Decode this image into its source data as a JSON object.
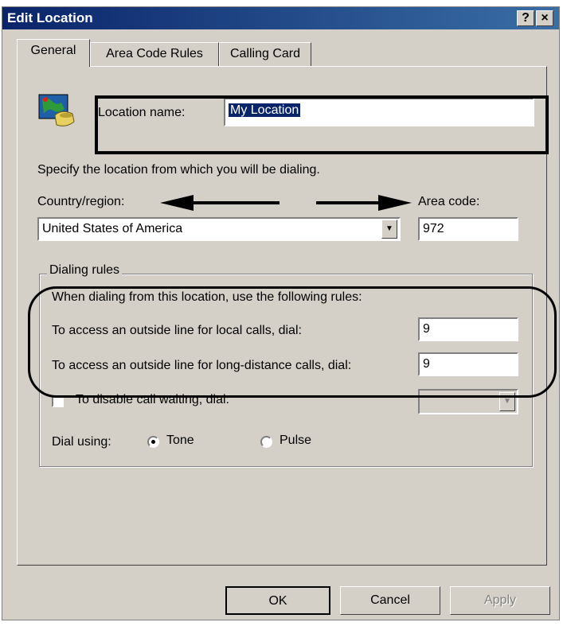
{
  "window": {
    "title": "Edit Location",
    "help_label": "?",
    "close_label": "×"
  },
  "tabs": [
    {
      "label": "General",
      "active": true
    },
    {
      "label": "Area Code Rules",
      "active": false
    },
    {
      "label": "Calling Card",
      "active": false
    }
  ],
  "general": {
    "icon": "location-phone-icon",
    "location_name_label": "Location name:",
    "location_name_value": "My Location",
    "specify_text": "Specify the location from which you will be dialing.",
    "country_label": "Country/region:",
    "country_value": "United States of America",
    "area_code_label": "Area code:",
    "area_code_value": "972"
  },
  "dialing_rules": {
    "group_label": "Dialing rules",
    "intro": "When dialing from this location, use the following rules:",
    "local_label": "To access an outside line for local calls, dial:",
    "local_value": "9",
    "long_distance_label": "To access an outside line for long-distance calls, dial:",
    "long_distance_value": "9",
    "disable_call_waiting_label": "To disable call waiting, dial:",
    "disable_call_waiting_checked": false,
    "dial_using_label": "Dial using:",
    "tone_label": "Tone",
    "pulse_label": "Pulse",
    "selected_mode": "Tone"
  },
  "buttons": {
    "ok": "OK",
    "cancel": "Cancel",
    "apply": "Apply"
  },
  "colors": {
    "titlebar": "#0a246a",
    "dialog_face": "#d4d0c8",
    "selection": "#0a246a"
  }
}
